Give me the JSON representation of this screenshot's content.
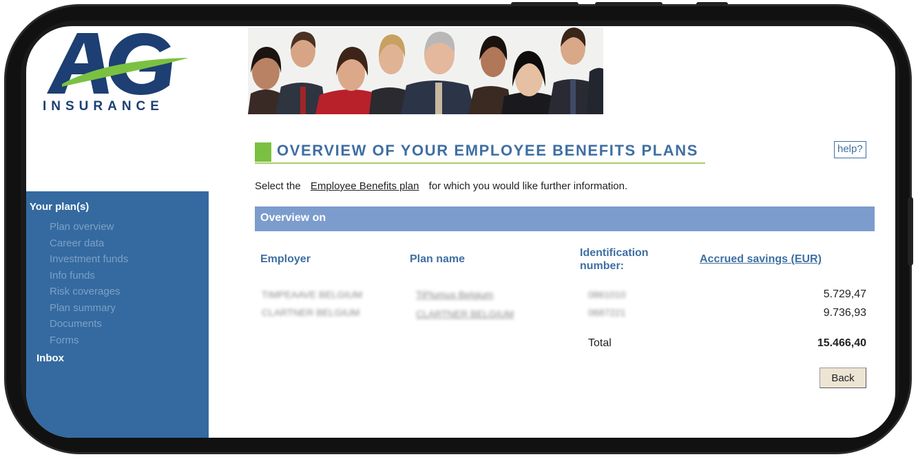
{
  "brand": {
    "logo_text": "INSURANCE",
    "colors": {
      "logo_blue": "#1d3f73",
      "logo_green": "#7ac142",
      "nav_blue": "#346aa0",
      "bar_blue": "#7c9cce"
    }
  },
  "banner": {
    "icon": "people-photo-banner"
  },
  "sidebar": {
    "section_label": "Your plan(s)",
    "items": [
      {
        "label": "Plan overview"
      },
      {
        "label": "Career data"
      },
      {
        "label": "Investment funds"
      },
      {
        "label": "Info funds"
      },
      {
        "label": "Risk coverages"
      },
      {
        "label": "Plan summary"
      },
      {
        "label": "Documents"
      },
      {
        "label": "Forms"
      }
    ],
    "inbox_label": "Inbox"
  },
  "main": {
    "title": "OVERVIEW OF YOUR EMPLOYEE BENEFITS PLANS",
    "help_label": "help?",
    "intro_before": "Select the",
    "intro_link": "Employee Benefits plan",
    "intro_after": "for which you would like further information.",
    "overview_label": "Overview on",
    "columns": {
      "employer": "Employer",
      "plan_name": "Plan name",
      "identification": "Identification number:",
      "accrued": "Accrued savings (EUR)"
    },
    "rows": [
      {
        "employer": "TIMPEAAVE BELGIUM",
        "plan_name": "TiPlumus Belgium",
        "id": "0861010",
        "amount": "5.729,47"
      },
      {
        "employer": "CLARTNER BELGIUM",
        "plan_name": "CLARTNER BELGIUM",
        "id": "0687221",
        "amount": "9.736,93"
      }
    ],
    "total_label": "Total",
    "total_value": "15.466,40",
    "back_label": "Back"
  }
}
